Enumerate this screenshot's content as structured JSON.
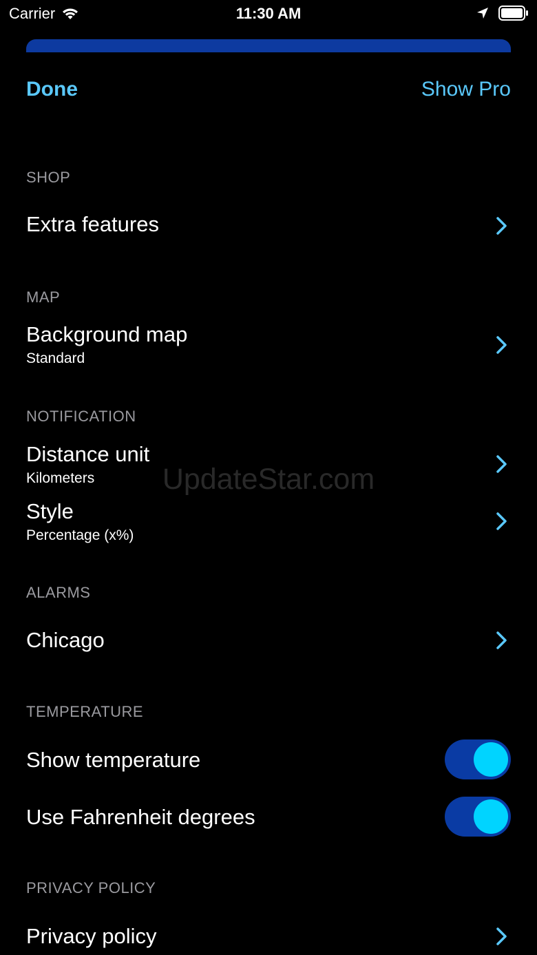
{
  "status_bar": {
    "carrier": "Carrier",
    "time": "11:30 AM",
    "wifi_icon": "wifi-icon",
    "location_icon": "location-arrow-icon",
    "battery_icon": "battery-icon"
  },
  "nav": {
    "done_label": "Done",
    "show_pro_label": "Show Pro",
    "accent_color": "#5ac8fa"
  },
  "sections": {
    "shop": {
      "header": "SHOP",
      "extra_features": "Extra features"
    },
    "map": {
      "header": "MAP",
      "background_map_title": "Background map",
      "background_map_value": "Standard"
    },
    "notification": {
      "header": "NOTIFICATION",
      "distance_unit_title": "Distance unit",
      "distance_unit_value": "Kilometers",
      "style_title": "Style",
      "style_value": "Percentage (x%)"
    },
    "alarms": {
      "header": "ALARMS",
      "chicago": "Chicago"
    },
    "temperature": {
      "header": "TEMPERATURE",
      "show_temperature": "Show temperature",
      "show_temperature_on": true,
      "use_fahrenheit": "Use Fahrenheit degrees",
      "use_fahrenheit_on": true
    },
    "privacy": {
      "header": "PRIVACY POLICY",
      "privacy_policy": "Privacy policy"
    }
  },
  "colors": {
    "background": "#000000",
    "toggle_track": "#0a3ba4",
    "toggle_knob": "#00d4ff",
    "section_header": "#9a9a9f"
  },
  "watermark": "UpdateStar.com"
}
